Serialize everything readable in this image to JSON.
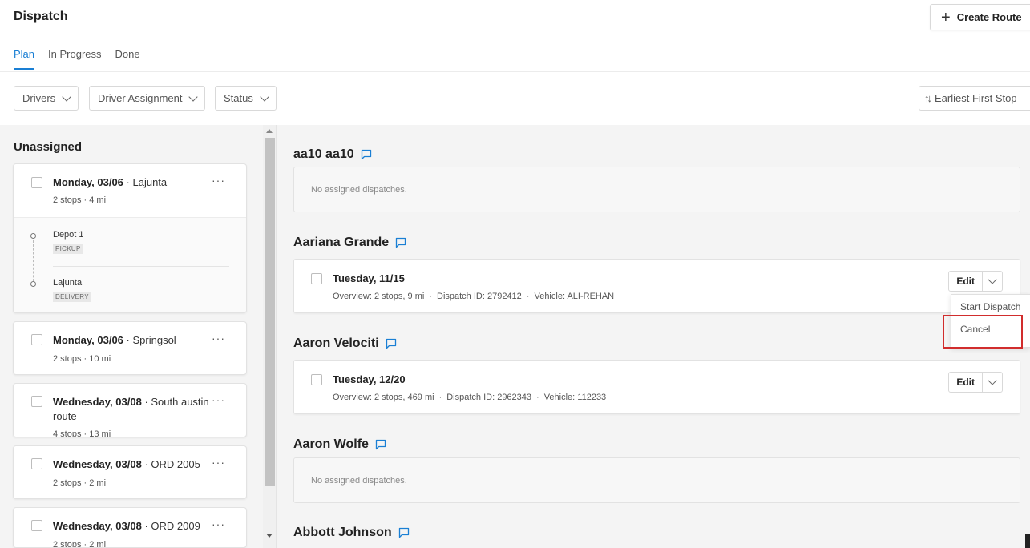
{
  "header": {
    "title": "Dispatch",
    "create_route_label": "Create Route"
  },
  "tabs": [
    {
      "label": "Plan",
      "active": true
    },
    {
      "label": "In Progress",
      "active": false
    },
    {
      "label": "Done",
      "active": false
    }
  ],
  "filters": {
    "drivers": "Drivers",
    "driver_assignment": "Driver Assignment",
    "status": "Status",
    "sort": "Earliest First Stop"
  },
  "unassigned": {
    "title": "Unassigned",
    "routes": [
      {
        "date": "Monday, 03/06",
        "location": "Lajunta",
        "stops": "2 stops",
        "distance": "4 mi",
        "stop_list": [
          {
            "name": "Depot 1",
            "type": "PICKUP"
          },
          {
            "name": "Lajunta",
            "type": "DELIVERY"
          }
        ]
      },
      {
        "date": "Monday, 03/06",
        "location": "Springsol",
        "stops": "2 stops",
        "distance": "10 mi"
      },
      {
        "date": "Wednesday, 03/08",
        "location": "South austin",
        "location_cont": "route",
        "stops": "4 stops",
        "distance": "13 mi"
      },
      {
        "date": "Wednesday, 03/08",
        "location": "ORD 2005",
        "stops": "2 stops",
        "distance": "2 mi"
      },
      {
        "date": "Wednesday, 03/08",
        "location": "ORD 2009",
        "stops": "2 stops",
        "distance": "2 mi"
      }
    ]
  },
  "drivers": [
    {
      "name": "aa10 aa10",
      "empty_text": "No assigned dispatches."
    },
    {
      "name": "Aariana Grande",
      "dispatch": {
        "date": "Tuesday, 11/15",
        "overview": "Overview: 2 stops, 9 mi",
        "dispatch_id": "Dispatch ID: 2792412",
        "vehicle": "Vehicle: ALI-REHAN",
        "edit_label": "Edit"
      }
    },
    {
      "name": "Aaron Velociti",
      "dispatch": {
        "date": "Tuesday, 12/20",
        "overview": "Overview: 2 stops, 469 mi",
        "dispatch_id": "Dispatch ID: 2962343",
        "vehicle": "Vehicle: 112233",
        "edit_label": "Edit"
      }
    },
    {
      "name": "Aaron Wolfe",
      "empty_text": "No assigned dispatches."
    },
    {
      "name": "Abbott Johnson"
    }
  ],
  "dropdown_menu": {
    "items": [
      "Start Dispatch",
      "Cancel"
    ],
    "highlighted": "Cancel"
  },
  "colors": {
    "accent": "#1a7fd4",
    "highlight_border": "#d12d2d",
    "panel_bg": "#f4f4f4"
  },
  "icons": {
    "create": "plus-icon",
    "chat": "chat-bubble-icon",
    "sort": "sort-arrows-icon",
    "more": "more-horizontal-icon",
    "dropdown": "chevron-down-icon"
  }
}
